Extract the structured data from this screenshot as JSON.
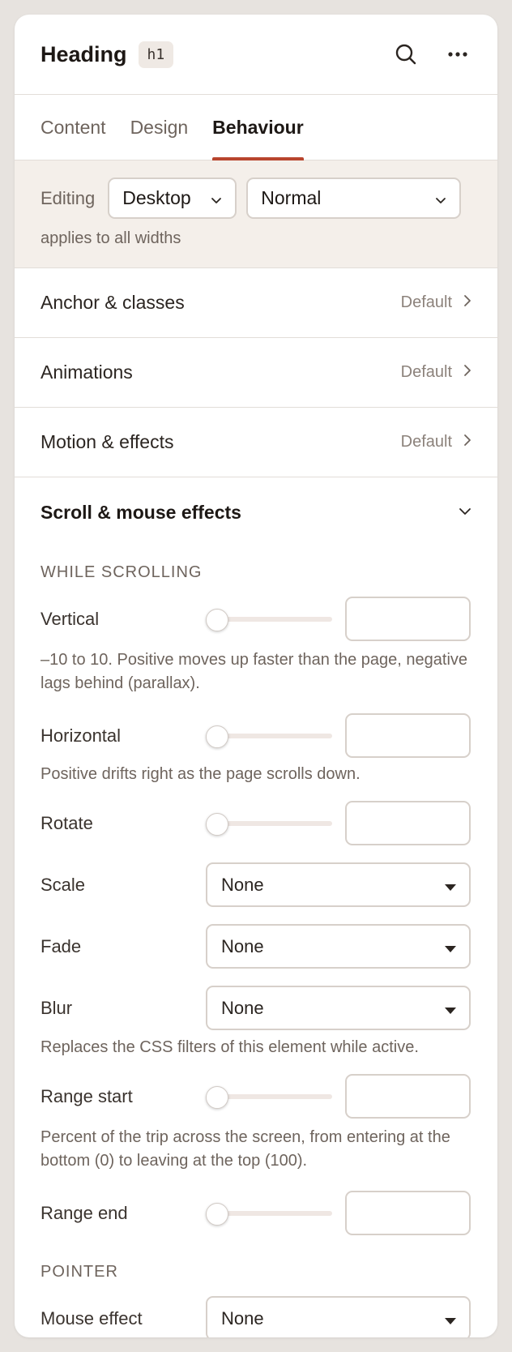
{
  "header": {
    "title": "Heading",
    "tag": "h1"
  },
  "tabs": [
    {
      "label": "Content",
      "active": false
    },
    {
      "label": "Design",
      "active": false
    },
    {
      "label": "Behaviour",
      "active": true
    }
  ],
  "editing": {
    "label": "Editing",
    "device": "Desktop",
    "state": "Normal",
    "note": "applies to all widths"
  },
  "accordion": [
    {
      "label": "Anchor & classes",
      "status": "Default"
    },
    {
      "label": "Animations",
      "status": "Default"
    },
    {
      "label": "Motion & effects",
      "status": "Default"
    }
  ],
  "scroll_section": {
    "title": "Scroll & mouse effects",
    "while_scrolling": "WHILE SCROLLING",
    "vertical": {
      "label": "Vertical",
      "value": "",
      "help": "–10 to 10. Positive moves up faster than the page, negative lags behind (parallax)."
    },
    "horizontal": {
      "label": "Horizontal",
      "value": "",
      "help": "Positive drifts right as the page scrolls down."
    },
    "rotate": {
      "label": "Rotate",
      "value": ""
    },
    "scale": {
      "label": "Scale",
      "value": "None"
    },
    "fade": {
      "label": "Fade",
      "value": "None"
    },
    "blur": {
      "label": "Blur",
      "value": "None",
      "help": "Replaces the CSS filters of this element while active."
    },
    "range_start": {
      "label": "Range start",
      "value": "",
      "help": "Percent of the trip across the screen, from entering at the bottom (0) to leaving at the top (100)."
    },
    "range_end": {
      "label": "Range end",
      "value": ""
    },
    "pointer": "POINTER",
    "mouse_effect": {
      "label": "Mouse effect",
      "value": "None"
    }
  },
  "colors": {
    "accent": "#b8452e",
    "panel_bg": "#ffffff",
    "page_bg": "#e7e3df",
    "editing_bg": "#f4efea"
  }
}
